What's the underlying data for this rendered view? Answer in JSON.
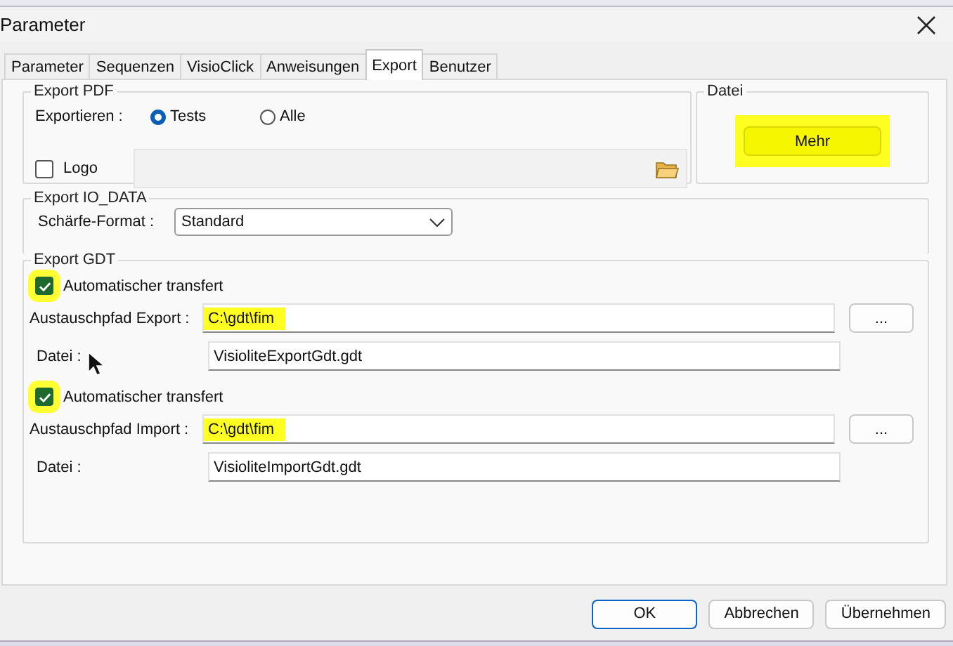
{
  "window": {
    "title": "Parameter"
  },
  "tabs": [
    {
      "label": "Parameter",
      "selected": false
    },
    {
      "label": "Sequenzen",
      "selected": false
    },
    {
      "label": "VisioClick",
      "selected": false
    },
    {
      "label": "Anweisungen",
      "selected": false
    },
    {
      "label": "Export",
      "selected": true
    },
    {
      "label": "Benutzer",
      "selected": false
    }
  ],
  "export_pdf": {
    "title": "Export PDF",
    "label": "Exportieren :",
    "options": [
      {
        "label": "Tests",
        "selected": true
      },
      {
        "label": "Alle",
        "selected": false
      }
    ],
    "logo": {
      "label": "Logo",
      "checked": false
    }
  },
  "datei": {
    "title": "Datei",
    "button": {
      "label": "Mehr",
      "highlighted": true
    }
  },
  "export_io_data": {
    "title": "Export IO_DATA",
    "label": "Schärfe-Format :",
    "value": "Standard"
  },
  "export_gdt": {
    "title": "Export GDT",
    "sections": [
      {
        "auto": {
          "label": "Automatischer transfert",
          "checked": true,
          "highlighted": true
        },
        "path_label": "Austauschpfad Export :",
        "path": "C:\\gdt\\fim",
        "path_highlighted": true,
        "browse": "...",
        "file_label": "Datei :",
        "file": "VisioliteExportGdt.gdt",
        "cursor": true
      },
      {
        "auto": {
          "label": "Automatischer transfert",
          "checked": true,
          "highlighted": true
        },
        "path_label": "Austauschpfad Import :",
        "path": "C:\\gdt\\fim",
        "path_highlighted": true,
        "browse": "...",
        "file_label": "Datei :",
        "file": "VisioliteImportGdt.gdt"
      }
    ]
  },
  "buttons": [
    {
      "label": "OK",
      "default": true
    },
    {
      "label": "Abbrechen",
      "default": false
    },
    {
      "label": "Übernehmen",
      "default": false
    }
  ]
}
